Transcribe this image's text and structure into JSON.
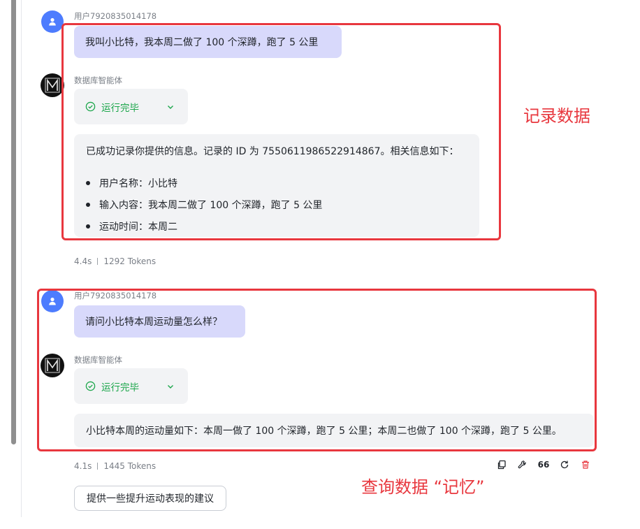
{
  "conversation": [
    {
      "user_name": "用户7920835014178",
      "user_message": "我叫小比特，我本周二做了 100 个深蹲，跑了 5 公里",
      "bot_name": "数据库智能体",
      "status_label": "运行完毕",
      "reply_intro": "已成功记录你提供的信息。记录的 ID 为 7550611986522914867。相关信息如下：",
      "reply_items": [
        "用户名称：小比特",
        "输入内容：我本周二做了 100 个深蹲，跑了 5 公里",
        "运动时间：本周二"
      ],
      "duration": "4.4s",
      "tokens": "1292 Tokens"
    },
    {
      "user_name": "用户7920835014178",
      "user_message": "请问小比特本周运动量怎么样？",
      "bot_name": "数据库智能体",
      "status_label": "运行完毕",
      "reply": "小比特本周的运动量如下：本周一做了 100 个深蹲，跑了 5 公里；本周二也做了 100 个深蹲，跑了 5 公里。",
      "duration": "4.1s",
      "tokens": "1445 Tokens"
    }
  ],
  "annotations": {
    "record_label": "记录数据",
    "query_label": "查询数据 “记忆”",
    "color": "#e8373e"
  },
  "actions": {
    "quote_glyph": "66",
    "icons": [
      "copy-icon",
      "wrench-icon",
      "quote-icon",
      "refresh-icon",
      "delete-icon"
    ]
  },
  "suggestion": "提供一些提升运动表现的建议",
  "colors": {
    "user_bubble": "#d8d9fb",
    "bot_card": "#f2f3f5",
    "status_green": "#1ca64b",
    "user_avatar": "#4d7cfe"
  }
}
